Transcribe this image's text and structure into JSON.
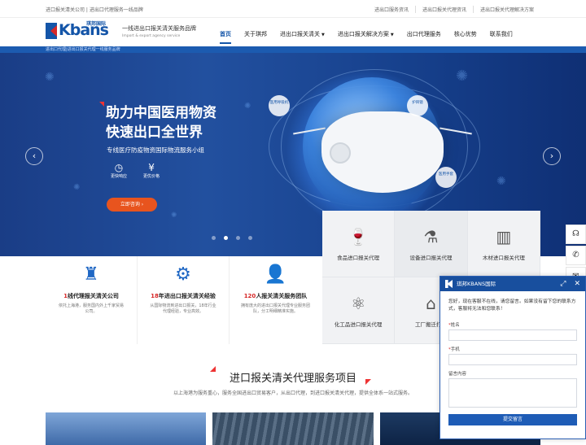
{
  "topbar": {
    "left_text": "进口报关清关公司 | 进出口代理服务一线品牌",
    "links": [
      "进出口服务资讯",
      "进出口报关代理资讯",
      "进出口报关代理解决方案"
    ]
  },
  "header": {
    "logo_brand": "Kbans",
    "logo_cn": "琪邦国际",
    "slogan": "一线进出口报关清关服务品牌",
    "slogan_en": "Import & export agency service",
    "nav": [
      {
        "label": "首页",
        "active": true,
        "dropdown": false
      },
      {
        "label": "关于琪邦",
        "active": false,
        "dropdown": false
      },
      {
        "label": "进出口报关清关",
        "active": false,
        "dropdown": true
      },
      {
        "label": "进出口报关解决方案",
        "active": false,
        "dropdown": true
      },
      {
        "label": "出口代理服务",
        "active": false,
        "dropdown": false
      },
      {
        "label": "核心优势",
        "active": false,
        "dropdown": false
      },
      {
        "label": "联系我们",
        "active": false,
        "dropdown": false
      }
    ]
  },
  "crumb": "进出口代理|进出口报关代理一线服务品牌",
  "hero": {
    "title_line1": "助力中国医用物资",
    "title_line2": "快速出口全世界",
    "subtitle": "专线医疗防疫物资国际物流服务小组",
    "features": [
      {
        "icon": "clock-icon",
        "glyph": "◷",
        "label": "更快响应"
      },
      {
        "icon": "yen-icon",
        "glyph": "¥",
        "label": "更优价格"
      }
    ],
    "consult_label": "立即咨询 ›",
    "bubbles": [
      "医用呼吸机",
      "护目镜",
      "医用手套"
    ],
    "prev": "‹",
    "next": "›",
    "slide_count": 4,
    "active_slide": 2
  },
  "services": [
    {
      "label": "食品进口报关代理",
      "icon": "wine-glass-icon",
      "glyph": "🍷"
    },
    {
      "label": "设备进口报关代理",
      "icon": "flask-icon",
      "glyph": "⚗"
    },
    {
      "label": "木材进口报关代理",
      "icon": "logs-icon",
      "glyph": "▥"
    },
    {
      "label": "化工品进口报关代理",
      "icon": "chemical-icon",
      "glyph": "⚛"
    },
    {
      "label": "工厂搬迁打包",
      "icon": "factory-icon",
      "glyph": "⌂"
    },
    {
      "label": "",
      "icon": "blank-icon",
      "glyph": ""
    }
  ],
  "stats": [
    {
      "num": "1",
      "text": "线代理报关清关公司",
      "desc": "依托上海港，服务国内外上千家贸易公司。",
      "icon": "shanghai-tower-icon",
      "glyph": "♜"
    },
    {
      "num": "18",
      "text": "年进出口报关清关经验",
      "desc": "从国际物流到进出口报关，18年行业代理经验，专业高效。",
      "icon": "monitor-gear-icon",
      "glyph": "⚙"
    },
    {
      "num": "120",
      "text": "人报关清关服务团队",
      "desc": "拥有庞大的进出口报关代理专业服务团队，分工明细精准实施。",
      "icon": "user-team-icon",
      "glyph": "👤"
    }
  ],
  "section": {
    "title": "进口报关清关代理服务项目",
    "subtitle": "以上海港为服务重心，服务全国进出口贸易客户，从出口代理，到进口报关清关代理，提供全体系一站式服务。"
  },
  "side_tools": [
    "headset-icon",
    "phone-icon",
    "wechat-icon"
  ],
  "chat": {
    "title": "琪邦KBANS国际",
    "message": "您好，现在客服不在线，请您留言。如果没有留下您的联系方式，客服将无法和您联系！",
    "name_label": "姓名",
    "phone_label": "手机",
    "content_label": "留言内容",
    "submit_label": "提交留言"
  },
  "colors": {
    "brand_blue": "#1455a8",
    "accent_red": "#d62828",
    "consult_orange": "#e8541e"
  }
}
